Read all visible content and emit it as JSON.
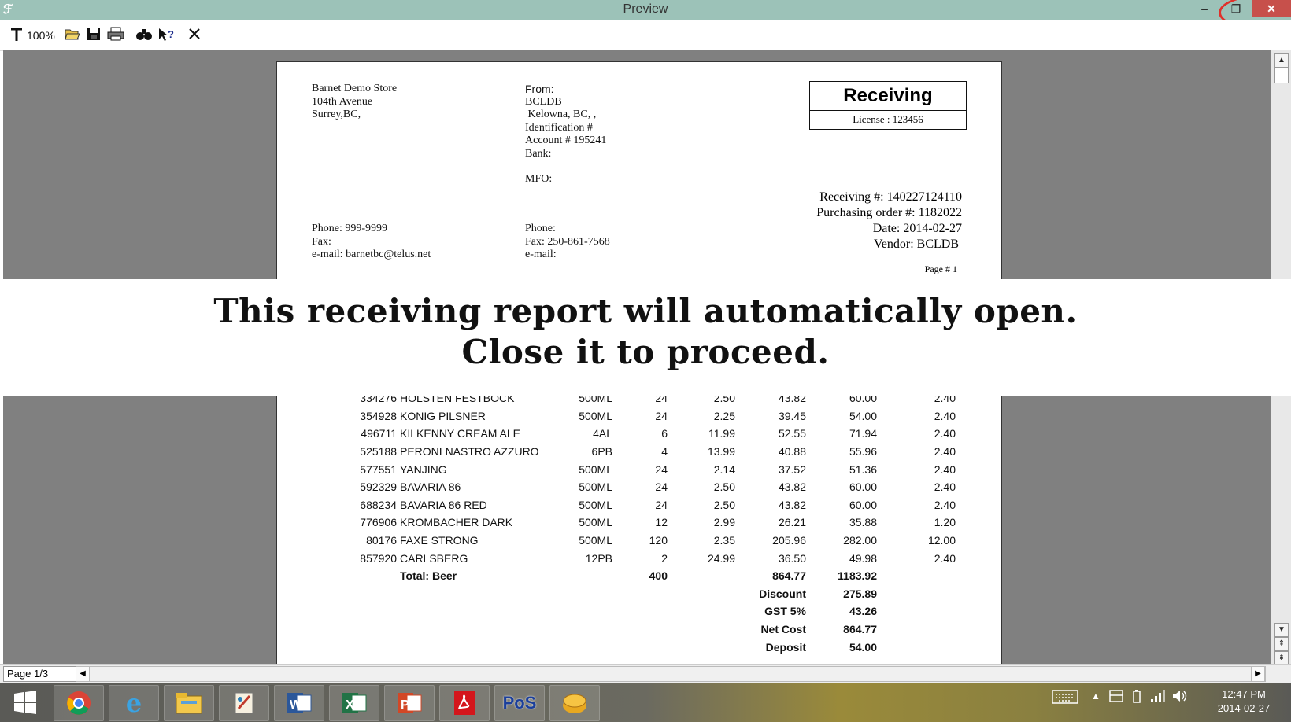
{
  "window": {
    "title": "Preview",
    "minimize": "–",
    "maximize": "❐",
    "close": "✕"
  },
  "toolbar": {
    "zoom": "100%",
    "icons": [
      "zoom-pin-icon",
      "open-folder-icon",
      "save-icon",
      "print-icon",
      "find-icon",
      "help-icon",
      "close-x-icon"
    ]
  },
  "report": {
    "store": {
      "name": "Barnet Demo Store",
      "line2": "104th Avenue",
      "line3": "Surrey,BC,",
      "phone": "Phone: 999-9999",
      "fax": "Fax:",
      "email": "e-mail: barnetbc@telus.net"
    },
    "from": {
      "label": "From:",
      "name": "BCLDB",
      "city": " Kelowna, BC, ,",
      "ident": "Identification #",
      "account": "Account # 195241",
      "bank": "Bank:",
      "mfo": "MFO:",
      "phone": "Phone:",
      "fax": "Fax: 250-861-7568",
      "email": "e-mail:"
    },
    "box": {
      "title": "Receiving",
      "license": "License :  123456"
    },
    "info": {
      "receiving": "Receiving #: 140227124110",
      "po": "Purchasing order #: 1182022",
      "date": "Date: 2014-02-27",
      "vendor": "Vendor: BCLDB "
    },
    "page_label": "Page # 1",
    "items": [
      {
        "code": "334276",
        "name": "HOLSTEN FESTBOCK",
        "size": "500ML",
        "qty": "24",
        "price": "2.50",
        "cost": "43.82",
        "total": "60.00",
        "dep": "2.40"
      },
      {
        "code": "354928",
        "name": "KONIG PILSNER",
        "size": "500ML",
        "qty": "24",
        "price": "2.25",
        "cost": "39.45",
        "total": "54.00",
        "dep": "2.40"
      },
      {
        "code": "496711",
        "name": "KILKENNY CREAM ALE",
        "size": "4AL",
        "qty": "6",
        "price": "11.99",
        "cost": "52.55",
        "total": "71.94",
        "dep": "2.40"
      },
      {
        "code": "525188",
        "name": "PERONI NASTRO AZZURO",
        "size": "6PB",
        "qty": "4",
        "price": "13.99",
        "cost": "40.88",
        "total": "55.96",
        "dep": "2.40"
      },
      {
        "code": "577551",
        "name": "YANJING",
        "size": "500ML",
        "qty": "24",
        "price": "2.14",
        "cost": "37.52",
        "total": "51.36",
        "dep": "2.40"
      },
      {
        "code": "592329",
        "name": "BAVARIA 86",
        "size": "500ML",
        "qty": "24",
        "price": "2.50",
        "cost": "43.82",
        "total": "60.00",
        "dep": "2.40"
      },
      {
        "code": "688234",
        "name": "BAVARIA 86 RED",
        "size": "500ML",
        "qty": "24",
        "price": "2.50",
        "cost": "43.82",
        "total": "60.00",
        "dep": "2.40"
      },
      {
        "code": "776906",
        "name": "KROMBACHER DARK",
        "size": "500ML",
        "qty": "12",
        "price": "2.99",
        "cost": "26.21",
        "total": "35.88",
        "dep": "1.20"
      },
      {
        "code": "80176",
        "name": "FAXE STRONG",
        "size": "500ML",
        "qty": "120",
        "price": "2.35",
        "cost": "205.96",
        "total": "282.00",
        "dep": "12.00"
      },
      {
        "code": "857920",
        "name": "CARLSBERG",
        "size": "12PB",
        "qty": "2",
        "price": "24.99",
        "cost": "36.50",
        "total": "49.98",
        "dep": "2.40"
      }
    ],
    "total": {
      "label": "Total: Beer",
      "qty": "400",
      "cost": "864.77",
      "total": "1183.92"
    },
    "summary": [
      {
        "label": "Discount",
        "value": "275.89"
      },
      {
        "label": "GST 5%",
        "value": "43.26"
      },
      {
        "label": "Net Cost",
        "value": "864.77"
      },
      {
        "label": "Deposit",
        "value": "54.00"
      }
    ]
  },
  "banner": {
    "line1": "This receiving report will automatically open.",
    "line2": "Close it to proceed."
  },
  "status": {
    "page": "Page 1/3"
  },
  "taskbar": {
    "apps": [
      "start",
      "chrome",
      "internet-explorer",
      "file-explorer",
      "paint",
      "word",
      "excel",
      "powerpoint",
      "acrobat",
      "PoS",
      "database"
    ],
    "pos_label": "PoS",
    "clock_time": "12:47 PM",
    "clock_date": "2014-02-27"
  },
  "colors": {
    "titlebar": "#9cc2b8",
    "close_button": "#c7504b",
    "viewer_bg": "#808080",
    "annotation_circle": "#e0302a"
  }
}
